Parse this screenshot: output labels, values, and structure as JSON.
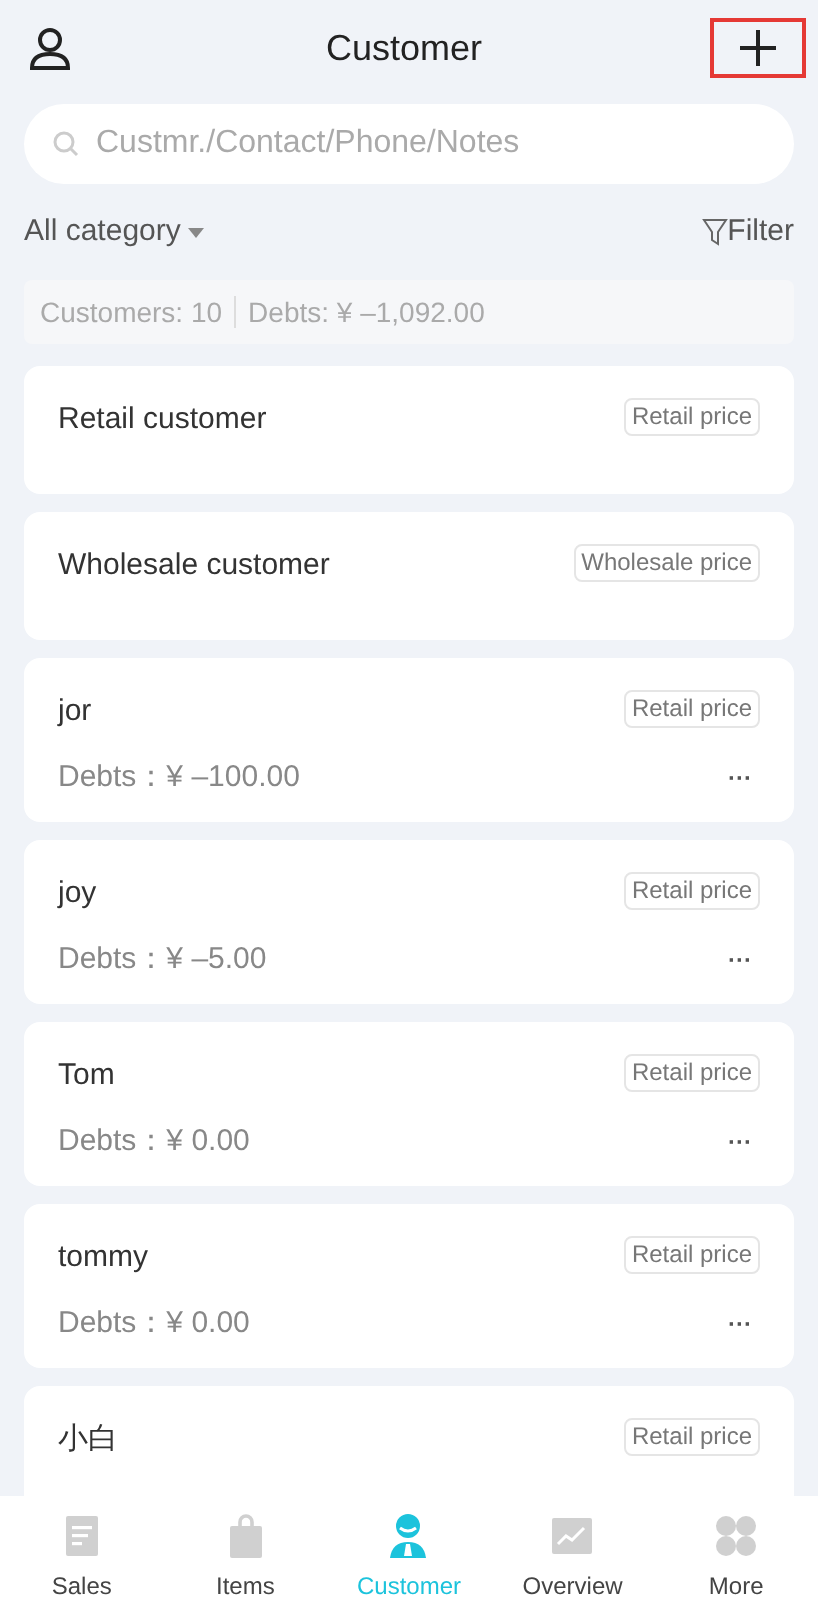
{
  "header": {
    "title": "Customer",
    "add_highlighted": true
  },
  "search": {
    "placeholder": "Custmr./Contact/Phone/Notes"
  },
  "category": {
    "label": "All category"
  },
  "filter": {
    "label": "Filter"
  },
  "summary": {
    "customers": "Customers: 10",
    "debts": "Debts: ¥ –1,092.00"
  },
  "customers": [
    {
      "name": "Retail customer",
      "price_tag": "Retail price"
    },
    {
      "name": "Wholesale customer",
      "price_tag": "Wholesale price"
    },
    {
      "name": "jor",
      "price_tag": "Retail price",
      "debts": "Debts：¥ –100.00",
      "more": "···"
    },
    {
      "name": "joy",
      "price_tag": "Retail price",
      "debts": "Debts：¥ –5.00",
      "more": "···"
    },
    {
      "name": "Tom",
      "price_tag": "Retail price",
      "debts": "Debts：¥ 0.00",
      "more": "···"
    },
    {
      "name": "tommy",
      "price_tag": "Retail price",
      "debts": "Debts：¥ 0.00",
      "more": "···"
    },
    {
      "name": "小白",
      "price_tag": "Retail price"
    }
  ],
  "tabs": [
    {
      "kind": "sales",
      "label": "Sales",
      "selected": false
    },
    {
      "kind": "items",
      "label": "Items",
      "selected": false
    },
    {
      "kind": "customer",
      "label": "Customer",
      "selected": true
    },
    {
      "kind": "overview",
      "label": "Overview",
      "selected": false
    },
    {
      "kind": "more",
      "label": "More",
      "selected": false
    }
  ]
}
